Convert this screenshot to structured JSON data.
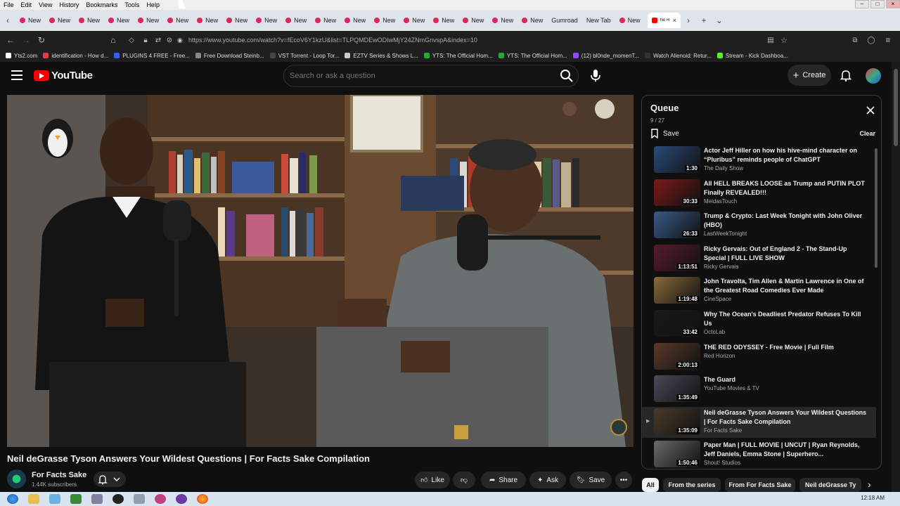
{
  "menubar": {
    "items": [
      "File",
      "Edit",
      "View",
      "History",
      "Bookmarks",
      "Tools",
      "Help"
    ]
  },
  "tabs": {
    "items": [
      "New",
      "New",
      "New",
      "New",
      "New",
      "New",
      "New",
      "New",
      "New",
      "New",
      "New",
      "New",
      "New",
      "New",
      "New",
      "New",
      "New",
      "New",
      "Gumroad",
      "New Tab",
      "New"
    ],
    "active_label": "Ne Ru"
  },
  "address": {
    "url": "https://www.youtube.com/watch?v=fEcoV6Y1kzU&list=TLPQMDEwODIwMjY24ZNmGnvspA&index=10"
  },
  "bookmarks": [
    {
      "label": "Yts2.com",
      "color": "#ffffff"
    },
    {
      "label": "identification - How d...",
      "color": "#e04040"
    },
    {
      "label": "PLUGINS 4 FREE - Free...",
      "color": "#3060ff"
    },
    {
      "label": "Free Download Steinb...",
      "color": "#888888"
    },
    {
      "label": "VST Torrent - Loop Tor...",
      "color": "#444444"
    },
    {
      "label": "EZTV Series & Shows L...",
      "color": "#cccccc"
    },
    {
      "label": "YTS: The Official Hom...",
      "color": "#22aa33"
    },
    {
      "label": "YTS: The Official Hom...",
      "color": "#22aa33"
    },
    {
      "label": "(12) bl0nde_momenT...",
      "color": "#9146ff"
    },
    {
      "label": "Watch Alienoid: Retur...",
      "color": "#333333"
    },
    {
      "label": "Stream - Kick Dashboa...",
      "color": "#53fc18"
    }
  ],
  "youtube": {
    "logo_text": "YouTube",
    "search_placeholder": "Search or ask a question",
    "create_label": "Create",
    "brand_color": "#ff0000"
  },
  "video": {
    "title": "Neil deGrasse Tyson Answers Your Wildest Questions | For Facts Sake Compilation",
    "channel": "For Facts Sake",
    "subscribers": "1.44K subscribers",
    "actions": [
      "Like",
      "Share",
      "Ask",
      "Save"
    ]
  },
  "queue": {
    "title": "Queue",
    "count": "9 / 27",
    "save_label": "Save",
    "clear_label": "Clear",
    "items": [
      {
        "title": "Actor Jeff Hiller on how his hive-mind character on “Pluribus” reminds people of ChatGPT",
        "channel": "The Daily Show",
        "duration": "1:30",
        "thumb": "#2a4a7a"
      },
      {
        "title": "All HELL BREAKS LOOSE as Trump and PUTIN PLOT Finally REVEALED!!!",
        "channel": "MeidasTouch",
        "duration": "30:33",
        "thumb": "#7a1a1a"
      },
      {
        "title": "Trump & Crypto: Last Week Tonight with John Oliver (HBO)",
        "channel": "LastWeekTonight",
        "duration": "26:33",
        "thumb": "#3a5a8a"
      },
      {
        "title": "Ricky Gervais: Out of England 2 - The Stand-Up Special | FULL LIVE SHOW",
        "channel": "Ricky Gervais",
        "duration": "1:13:51",
        "thumb": "#5a1a2a"
      },
      {
        "title": "John Travolta, Tim Allen & Martin Lawrence in One of the Greatest Road Comedies Ever Made",
        "channel": "CineSpace",
        "duration": "1:19:48",
        "thumb": "#8a6a3a"
      },
      {
        "title": "Why The Ocean's Deadliest Predator Refuses To Kill Us",
        "channel": "OctoLab",
        "duration": "33:42",
        "thumb": "#1a1a1a"
      },
      {
        "title": "THE RED ODYSSEY - Free Movie | Full Film",
        "channel": "Red Horizon",
        "duration": "2:00:13",
        "thumb": "#5a3a2a"
      },
      {
        "title": "The Guard",
        "channel": "YouTube Movies & TV",
        "duration": "1:35:49",
        "thumb": "#4a4a5a"
      },
      {
        "title": "Neil deGrasse Tyson Answers Your Wildest Questions | For Facts Sake Compilation",
        "channel": "For Facts Sake",
        "duration": "1:35:09",
        "thumb": "#4a3a2a"
      },
      {
        "title": "Paper Man | FULL MOVIE | UNCUT | Ryan Reynolds, Jeff Daniels, Emma Stone | Superhero...",
        "channel": "Shout! Studios",
        "duration": "1:50:46",
        "thumb": "#6a6a6a"
      }
    ]
  },
  "chips": [
    "All",
    "From the series",
    "From For Facts Sake",
    "Neil deGrasse Ty"
  ],
  "taskbar": {
    "time": "12:18 AM"
  }
}
